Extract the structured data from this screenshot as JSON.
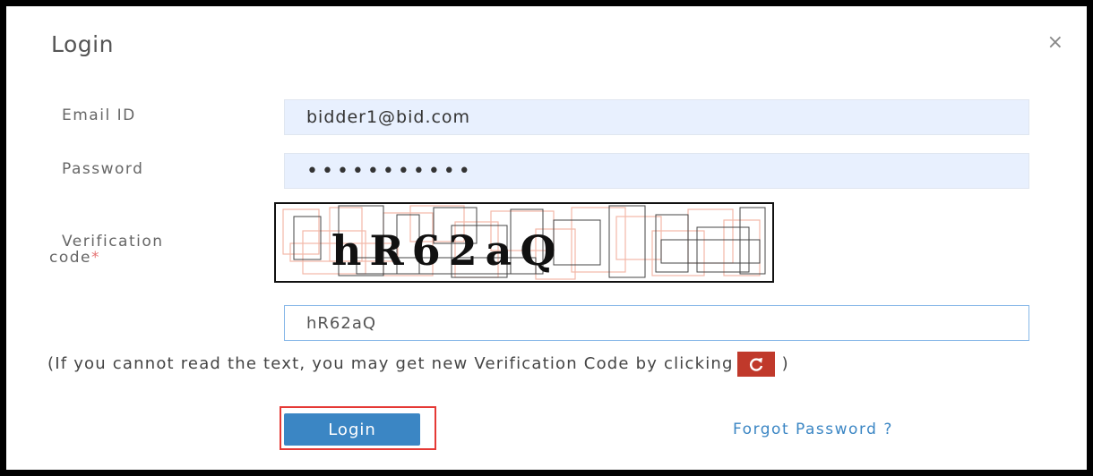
{
  "dialog": {
    "title": "Login",
    "close_symbol": "×"
  },
  "form": {
    "email_label": "Email ID",
    "email_value": "bidder1@bid.com",
    "password_label": "Password",
    "password_value": "bidderpass1",
    "verification_label_line1": "Verification",
    "verification_label_line2": "code",
    "required_marker": "*",
    "captcha_text": "hR62aQ",
    "verification_value": "hR62aQ"
  },
  "help": {
    "text_before": "(If you cannot read the text, you may get new Verification Code by clicking",
    "text_after": ")",
    "refresh_icon": "refresh-icon"
  },
  "actions": {
    "login_label": "Login",
    "forgot_label": "Forgot Password ?"
  },
  "colors": {
    "primary": "#3b86c4",
    "refresh_bg": "#c0392b",
    "highlight": "#e53935",
    "autofill_bg": "#e8f0fe"
  }
}
